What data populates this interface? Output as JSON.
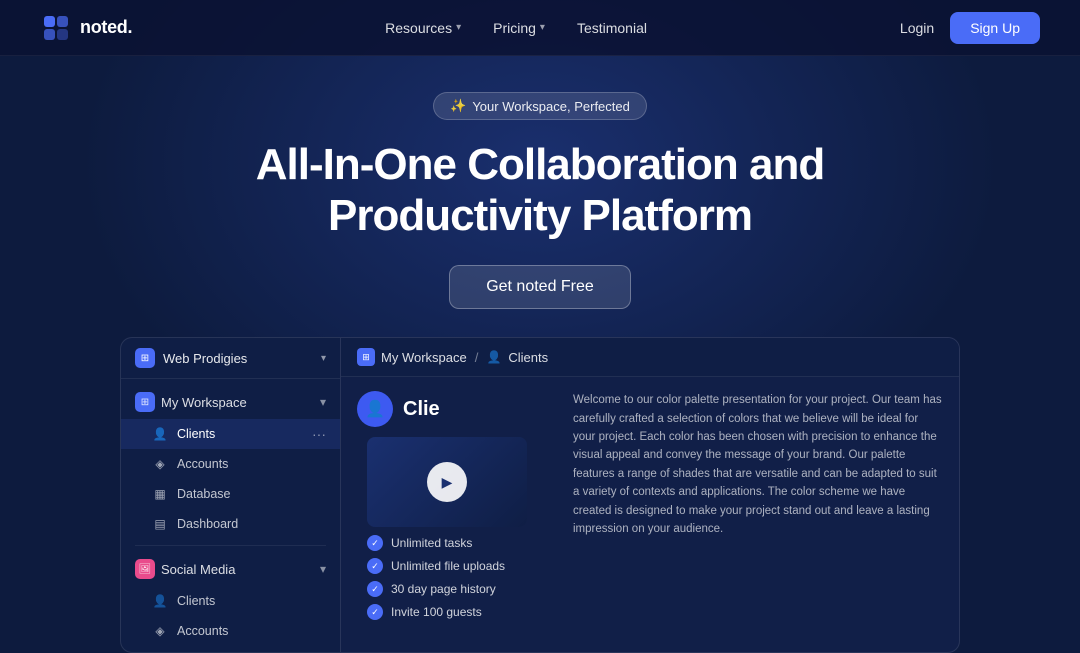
{
  "brand": {
    "name": "noted.",
    "logo_symbol": "◈"
  },
  "navbar": {
    "links": [
      {
        "label": "Resources",
        "has_dropdown": true
      },
      {
        "label": "Pricing",
        "has_dropdown": true
      },
      {
        "label": "Testimonial",
        "has_dropdown": false
      }
    ],
    "login_label": "Login",
    "signup_label": "Sign Up"
  },
  "hero": {
    "badge_emoji": "✨",
    "badge_text": "Your Workspace, Perfected",
    "title_line1": "All-In-One Collaboration and",
    "title_line2": "Productivity Platform",
    "cta_label": "Get noted Free"
  },
  "sidebar": {
    "workspace_selector": "Web Prodigies",
    "sections": [
      {
        "label": "My Workspace",
        "expanded": true,
        "items": [
          {
            "label": "Clients",
            "active": true
          },
          {
            "label": "Accounts",
            "active": false
          },
          {
            "label": "Database",
            "active": false
          },
          {
            "label": "Dashboard",
            "active": false
          }
        ]
      },
      {
        "label": "Social Media",
        "expanded": true,
        "items": [
          {
            "label": "Clients",
            "active": false
          },
          {
            "label": "Accounts",
            "active": false
          }
        ]
      }
    ]
  },
  "content": {
    "breadcrumb": {
      "workspace": "My Workspace",
      "separator": "/",
      "page": "Clients"
    },
    "page_title": "Clie",
    "video_play_tooltip": "Play video",
    "features": [
      "Unlimited tasks",
      "Unlimited file uploads",
      "30 day page history",
      "Invite 100 guests"
    ],
    "description": "Welcome to our color palette presentation for your project. Our team has carefully crafted a selection of colors that we believe will be ideal for your project. Each color has been chosen with precision to enhance the visual appeal and convey the message of your brand. Our palette features a range of shades that are versatile and can be adapted to suit a variety of contexts and applications. The color scheme we have created is designed to make your project stand out and leave a lasting impression on your audience."
  },
  "icons": {
    "play": "▶",
    "check": "✓",
    "chevron_down": "▾",
    "dots": "···",
    "workspace_icon": "⊞",
    "clients_icon": "👤",
    "accounts_icon": "◈",
    "database_icon": "▦",
    "dashboard_icon": "▤"
  },
  "colors": {
    "primary": "#4a6cf7",
    "bg_dark": "#0d1b3e",
    "panel_bg": "#0f1e45",
    "accent": "#3d5af1"
  }
}
